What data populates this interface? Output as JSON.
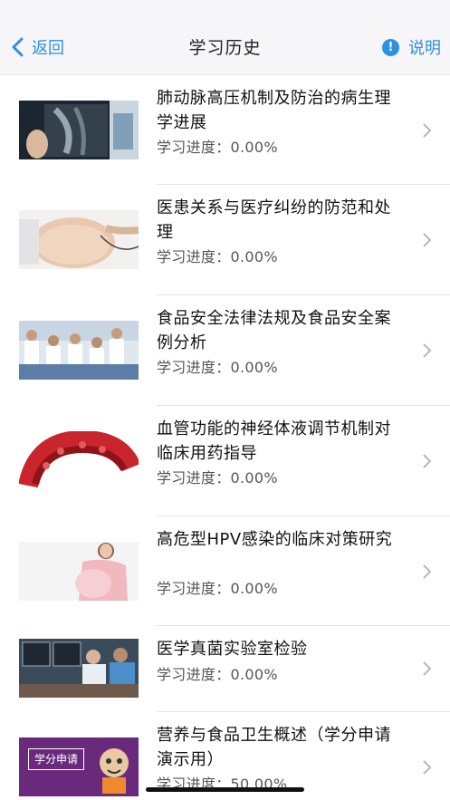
{
  "nav": {
    "back_label": "返回",
    "title": "学习历史",
    "help_label": "说明",
    "accent": "#2f8fe0"
  },
  "courses": [
    {
      "title": "肺动脉高压机制及防治的病生理学进展",
      "progress_label": "学习进度：",
      "progress": "0.00%",
      "thumb_icon": "xray-image"
    },
    {
      "title": "医患关系与医疗纠纷的防范和处理",
      "progress_label": "学习进度：",
      "progress": "0.00%",
      "thumb_icon": "pregnancy-checkup-image"
    },
    {
      "title": "食品安全法律法规及食品安全案例分析",
      "progress_label": "学习进度：",
      "progress": "0.00%",
      "thumb_icon": "doctors-team-image"
    },
    {
      "title": "血管功能的神经体液调节机制对临床用药指导",
      "progress_label": "学习进度：",
      "progress": "0.00%",
      "thumb_icon": "blood-vessel-image"
    },
    {
      "title": "高危型HPV感染的临床对策研究",
      "progress_label": "学习进度：",
      "progress": "0.00%",
      "thumb_icon": "pregnant-woman-image"
    },
    {
      "title": "医学真菌实验室检验",
      "progress_label": "学习进度：",
      "progress": "0.00%",
      "thumb_icon": "lab-doctors-image"
    },
    {
      "title": "营养与食品卫生概述（学分申请演示用）",
      "progress_label": "学习进度：",
      "progress": "50.00%",
      "thumb_icon": "credit-application-banner",
      "thumb_text": "学分申请"
    }
  ]
}
